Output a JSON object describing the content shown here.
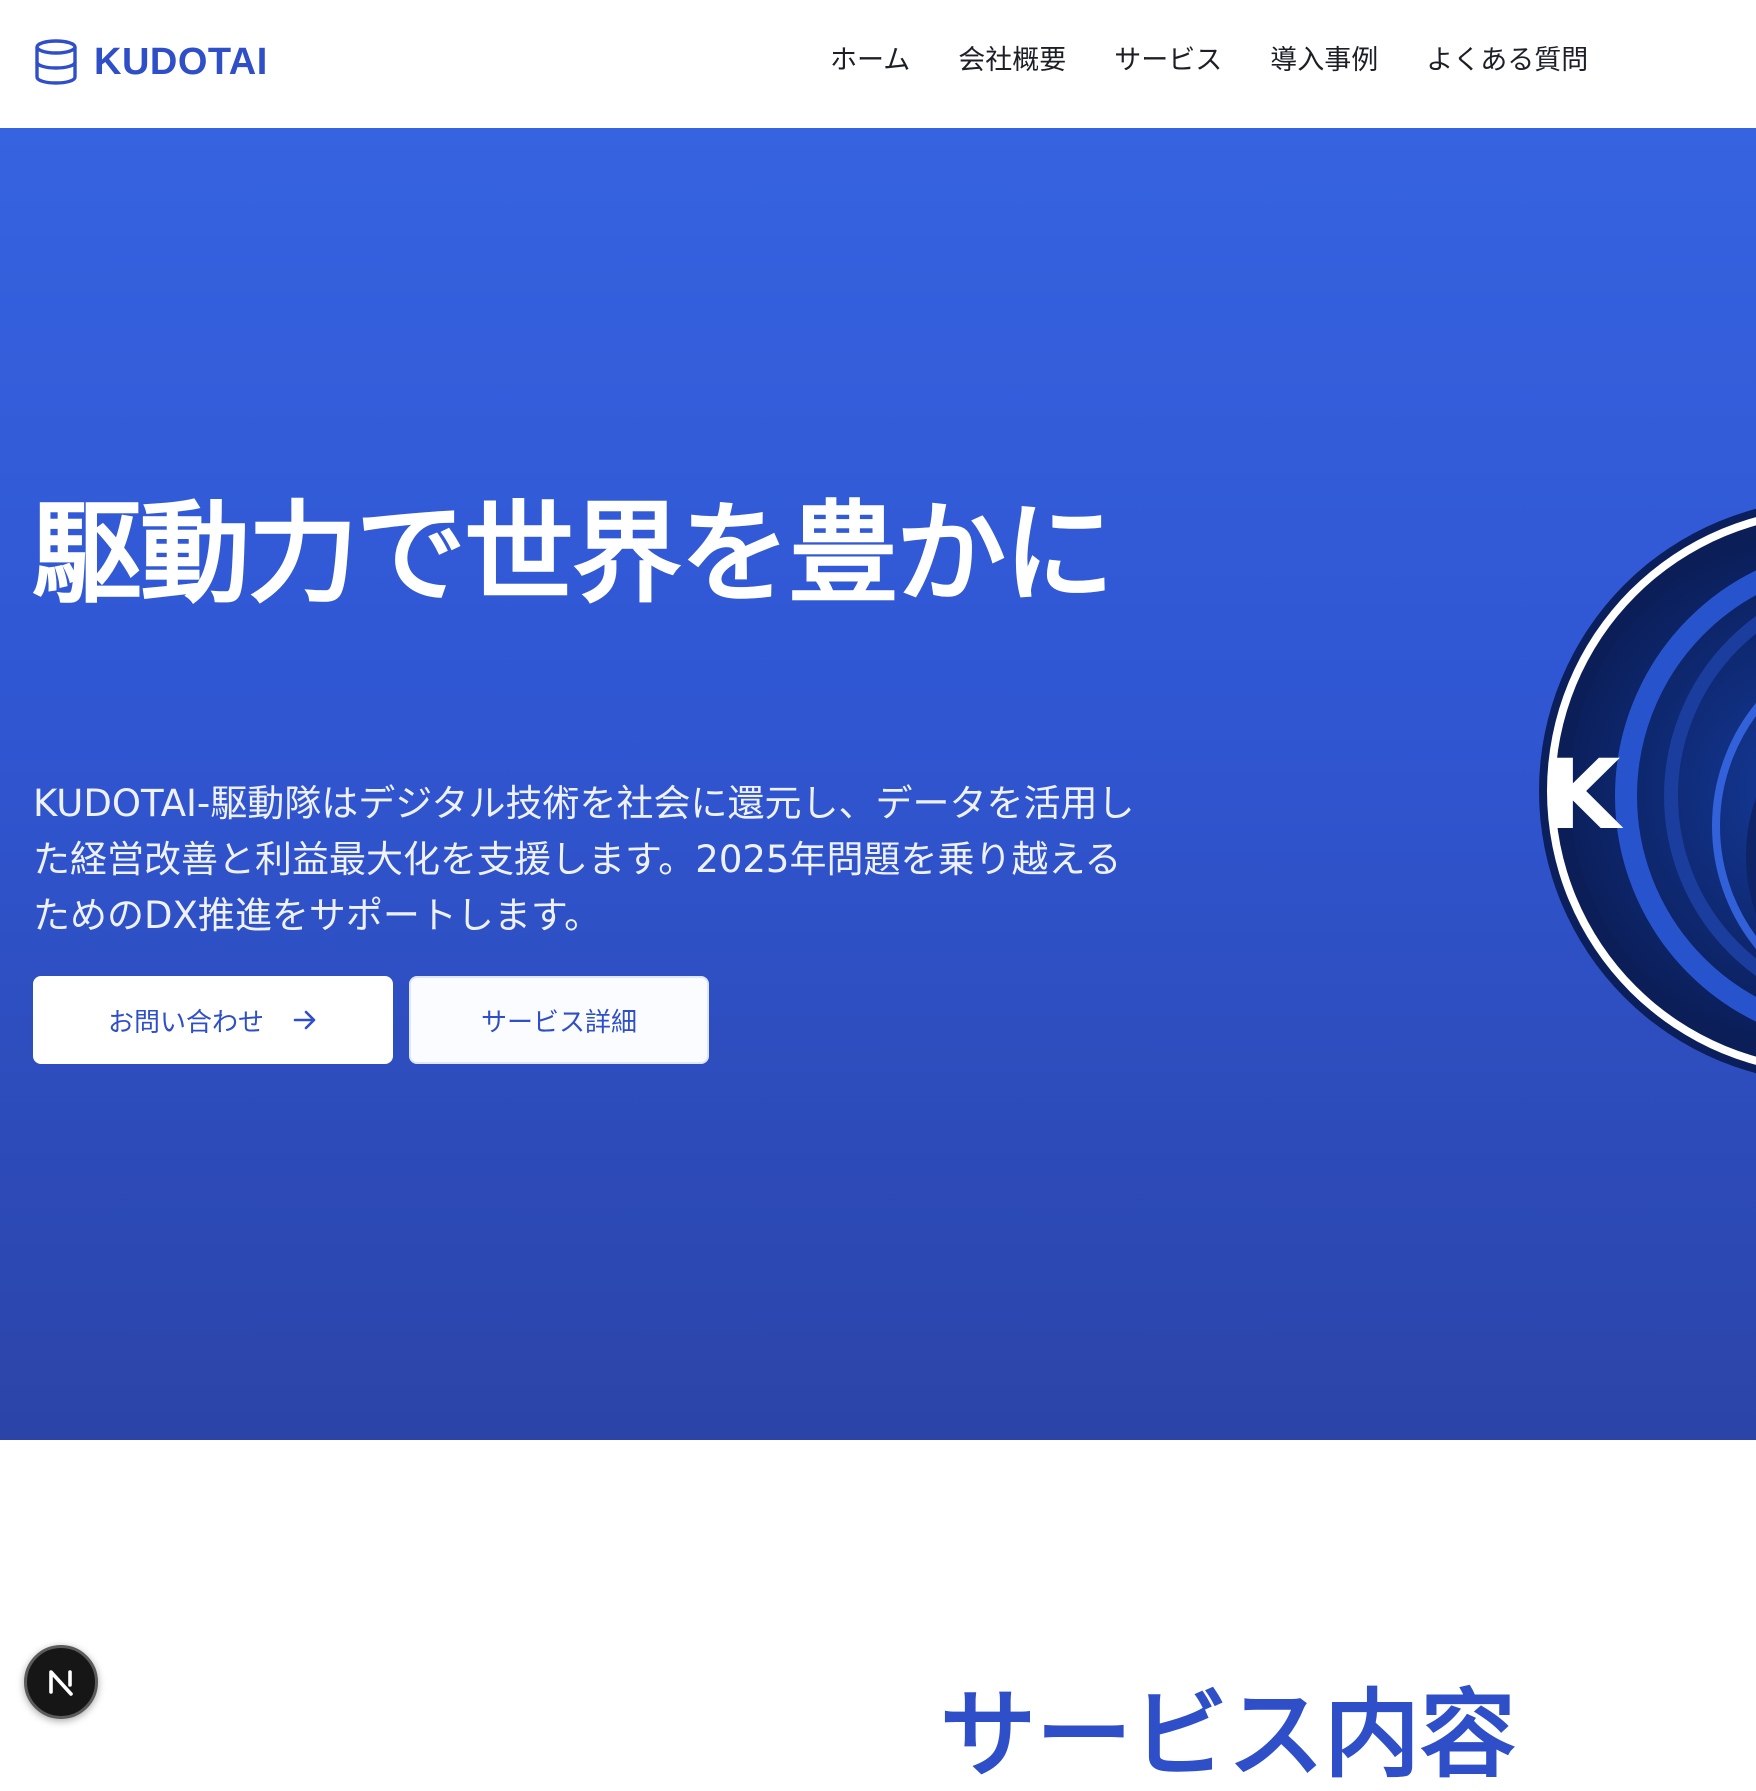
{
  "header": {
    "logo_text": "KUDOTAI",
    "logo_icon": "database-icon",
    "nav": [
      {
        "label": "ホーム"
      },
      {
        "label": "会社概要"
      },
      {
        "label": "サービス"
      },
      {
        "label": "導入事例"
      },
      {
        "label": "よくある質問"
      }
    ]
  },
  "hero": {
    "title": "駆動力で世界を豊かに",
    "lead": "KUDOTAI-駆動隊はデジタル技術を社会に還元し、データを活用した経営改善と利益最大化を支援します。2025年問題を乗り越えるためのDX推進をサポートします。",
    "contact_button": "お問い合わせ",
    "contact_button_icon": "arrow-right-icon",
    "services_button": "サービス詳細",
    "emblem_letter": "K"
  },
  "services_section": {
    "title": "サービス内容"
  },
  "dev_badge": {
    "letter": "N"
  },
  "colors": {
    "brand": "#2f4fc9",
    "hero_top": "#3663e0",
    "hero_bottom": "#2b44a8",
    "emblem_dark": "#0b1f5c"
  }
}
